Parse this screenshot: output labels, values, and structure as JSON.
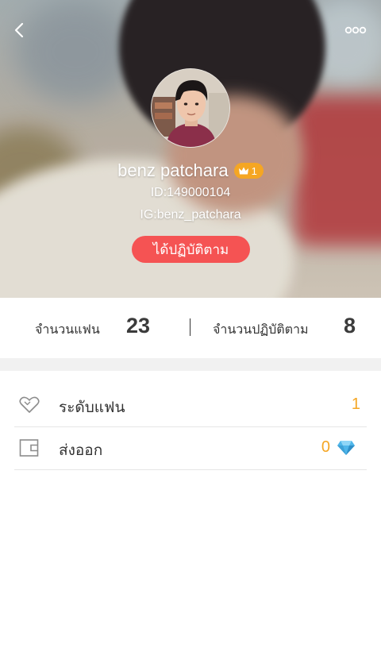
{
  "header": {
    "back_icon": "chevron-left-icon",
    "more_icon": "more-dots-icon"
  },
  "profile": {
    "username": "benz patchara",
    "level": "1",
    "level_icon": "crown-icon",
    "id_text": "ID:149000104",
    "ig_text": "IG:benz_patchara",
    "follow_button_label": "ได้ปฏิบัติตาม"
  },
  "stats": {
    "fans_label": "จำนวนแฟน",
    "fans_value": "23",
    "following_label": "จำนวนปฏิบัติตาม",
    "following_value": "8"
  },
  "menu": {
    "items": [
      {
        "label": "ระดับแฟน",
        "value": "1",
        "icon": "heart-outline-icon"
      },
      {
        "label": "ส่งออก",
        "value": "0",
        "icon": "wallet-icon",
        "suffix_icon": "diamond-icon"
      }
    ]
  },
  "colors": {
    "accent": "#f5a623",
    "follow_button": "#f55353",
    "gem": "#4fb6ea",
    "text": "#333333",
    "divider": "#e6e6e6",
    "band": "#f1f1f1"
  }
}
